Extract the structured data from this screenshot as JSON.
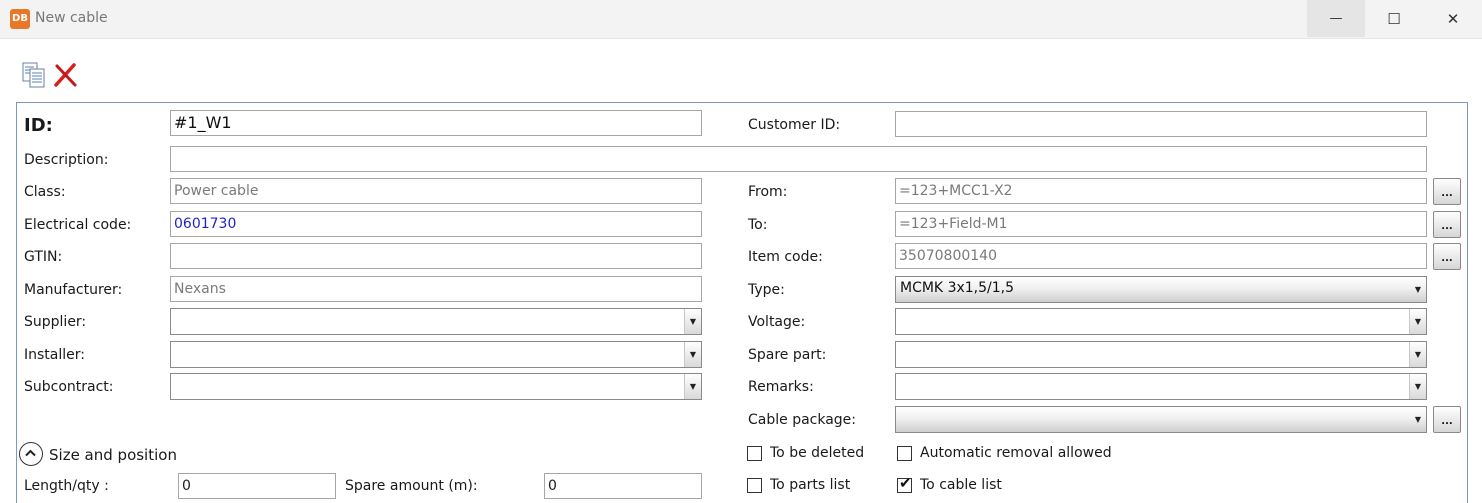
{
  "window": {
    "app_icon_text": "DB",
    "title": "New cable",
    "min_glyph": "—",
    "max_glyph": "☐",
    "close_glyph": "✕"
  },
  "toolbar": {
    "icons": [
      "document-copy-icon",
      "delete-x-icon"
    ]
  },
  "colors": {
    "accent": "#e8772a",
    "frame_border": "#7a98c9",
    "link_value": "#2222cc",
    "readonly_text": "#7a7a7a"
  },
  "form": {
    "id_label": "ID:",
    "id_value": "#1_W1",
    "customer_id_label": "Customer ID:",
    "customer_id_value": "",
    "description_label": "Description:",
    "description_value": "",
    "class_label": "Class:",
    "class_value": "Power cable",
    "electrical_code_label": "Electrical code:",
    "electrical_code_value": "0601730",
    "gtin_label": "GTIN:",
    "gtin_value": "",
    "manufacturer_label": "Manufacturer:",
    "manufacturer_value": "Nexans",
    "supplier_label": "Supplier:",
    "supplier_value": "",
    "installer_label": "Installer:",
    "installer_value": "",
    "subcontract_label": "Subcontract:",
    "subcontract_value": "",
    "from_label": "From:",
    "from_value": "=123+MCC1-X2",
    "to_label": "To:",
    "to_value": "=123+Field-M1",
    "item_code_label": "Item code:",
    "item_code_value": "35070800140",
    "type_label": "Type:",
    "type_value": "MCMK 3x1,5/1,5",
    "voltage_label": "Voltage:",
    "voltage_value": "",
    "spare_part_label": "Spare part:",
    "spare_part_value": "",
    "remarks_label": "Remarks:",
    "remarks_value": "",
    "cable_package_label": "Cable package:",
    "cable_package_value": "",
    "browse_label": "...",
    "dropdown_glyph": "▼",
    "check_glyph": "✔",
    "to_be_deleted_label": "To be deleted",
    "to_be_deleted_checked": false,
    "automatic_removal_label": "Automatic removal allowed",
    "automatic_removal_checked": false,
    "to_parts_list_label": "To parts list",
    "to_parts_list_checked": false,
    "to_cable_list_label": "To cable list",
    "to_cable_list_checked": true
  },
  "size_section": {
    "title": "Size and position",
    "length_label": "Length/qty :",
    "length_value": "0",
    "spare_amount_label": "Spare amount (m):",
    "spare_amount_value": "0"
  }
}
